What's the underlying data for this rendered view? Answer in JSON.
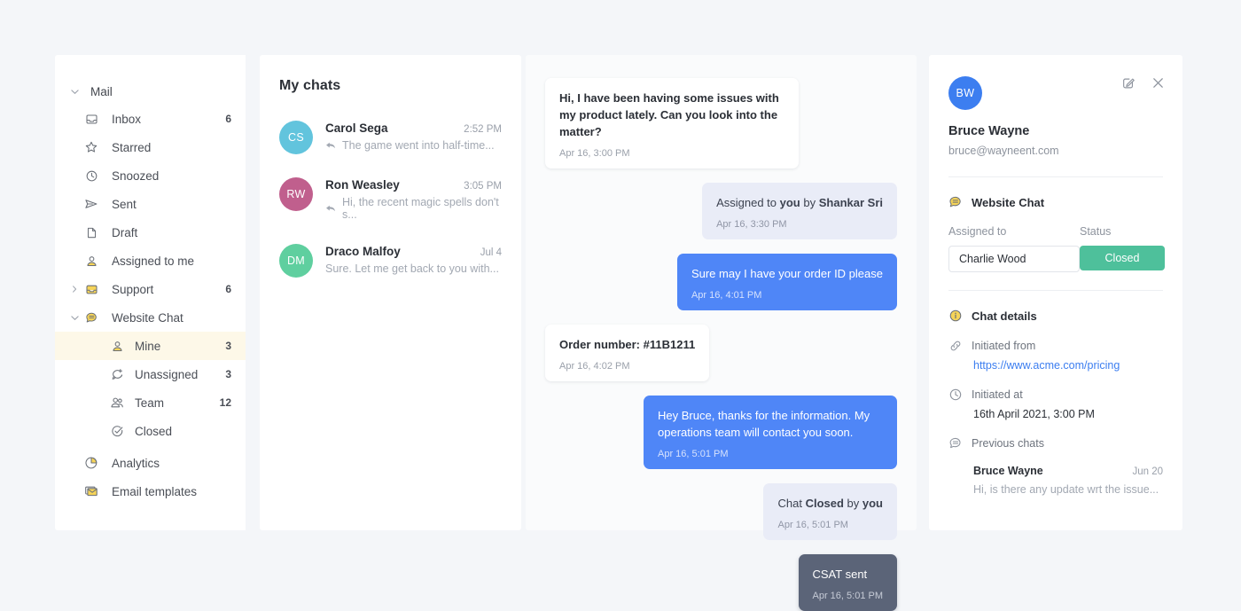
{
  "sidebar": {
    "group": {
      "label": "Mail",
      "caret": "chevron-down"
    },
    "items": [
      {
        "label": "Inbox",
        "count": "6",
        "icon": "inbox-icon",
        "level": 1
      },
      {
        "label": "Starred",
        "count": "",
        "icon": "star-icon",
        "level": 1
      },
      {
        "label": "Snoozed",
        "count": "",
        "icon": "clock-icon",
        "level": 1
      },
      {
        "label": "Sent",
        "count": "",
        "icon": "send-icon",
        "level": 1
      },
      {
        "label": "Draft",
        "count": "",
        "icon": "document-icon",
        "level": 1
      },
      {
        "label": "Assigned to me",
        "count": "",
        "icon": "person-icon",
        "level": 1
      },
      {
        "label": "Support",
        "count": "6",
        "icon": "tray-icon",
        "level": 1
      },
      {
        "label": "Website Chat",
        "count": "",
        "icon": "chat-bubble-icon",
        "level": 1
      },
      {
        "label": "Mine",
        "count": "3",
        "icon": "person-icon",
        "level": 2
      },
      {
        "label": "Unassigned",
        "count": "3",
        "icon": "chat-plus-icon",
        "level": 2
      },
      {
        "label": "Team",
        "count": "12",
        "icon": "people-icon",
        "level": 2
      },
      {
        "label": "Closed",
        "count": "",
        "icon": "check-circle-icon",
        "level": 2
      },
      {
        "label": "Analytics",
        "count": "",
        "icon": "pie-chart-icon",
        "level": 1
      },
      {
        "label": "Email templates",
        "count": "",
        "icon": "envelope-icon",
        "level": 1
      }
    ],
    "selected_label": "Mine"
  },
  "chatlist": {
    "title": "My chats",
    "rows": [
      {
        "initials": "CS",
        "color": "#62c4dd",
        "name": "Carol Sega",
        "time": "2:52 PM",
        "preview": "The game went into half-time...",
        "has_reply_icon": true
      },
      {
        "initials": "RW",
        "color": "#c05f8d",
        "name": "Ron Weasley",
        "time": "3:05 PM",
        "preview": "Hi, the recent magic spells don't s...",
        "has_reply_icon": true
      },
      {
        "initials": "DM",
        "color": "#5fcf9f",
        "name": "Draco Malfoy",
        "time": "Jul 4",
        "preview": "Sure. Let me get back to you with...",
        "has_reply_icon": false
      }
    ]
  },
  "conversation": {
    "messages": [
      {
        "kind": "cust",
        "align": "left",
        "text": "Hi, I have been having some issues with my product lately. Can you look into the matter?",
        "time": "Apr 16, 3:00 PM"
      },
      {
        "kind": "sys",
        "align": "right",
        "text": "Assigned to you by Shankar Sri",
        "bold_parts": [
          "you",
          "Shankar Sri"
        ],
        "time": "Apr 16, 3:30 PM"
      },
      {
        "kind": "agent",
        "align": "right",
        "text": "Sure may I have your order ID please",
        "time": "Apr 16, 4:01 PM"
      },
      {
        "kind": "cust",
        "align": "left",
        "text": "Order number: #11B1211",
        "time": "Apr 16, 4:02 PM"
      },
      {
        "kind": "agent",
        "align": "right",
        "text": "Hey Bruce, thanks for the information. My operations team will contact you soon.",
        "time": "Apr 16, 5:01 PM"
      },
      {
        "kind": "sys",
        "align": "right",
        "text": "Chat Closed by you",
        "bold_parts": [
          "Closed",
          "you"
        ],
        "time": "Apr 16, 5:01 PM"
      },
      {
        "kind": "dark",
        "align": "right",
        "text": "CSAT sent",
        "time": "Apr 16, 5:01 PM"
      }
    ]
  },
  "detail": {
    "avatar_initials": "BW",
    "avatar_color": "#3c7ef0",
    "name": "Bruce Wayne",
    "email": "bruce@wayneent.com",
    "edit_icon": "edit-icon",
    "close_icon": "close-icon",
    "channel": {
      "label": "Website Chat",
      "icon": "chat-bubble-icon"
    },
    "assigned_label": "Assigned to",
    "assigned_value": "Charlie Wood",
    "status_label": "Status",
    "status_value": "Closed",
    "status_color": "#4ec09b",
    "chat_details_label": "Chat details",
    "initiated_from_label": "Initiated from",
    "initiated_from_value": "https://www.acme.com/pricing",
    "initiated_at_label": "Initiated at",
    "initiated_at_value": "16th April 2021, 3:00 PM",
    "previous_chats_label": "Previous chats",
    "previous": [
      {
        "name": "Bruce Wayne",
        "date": "Jun 20",
        "preview": "Hi, is there any update wrt the issue..."
      }
    ]
  }
}
